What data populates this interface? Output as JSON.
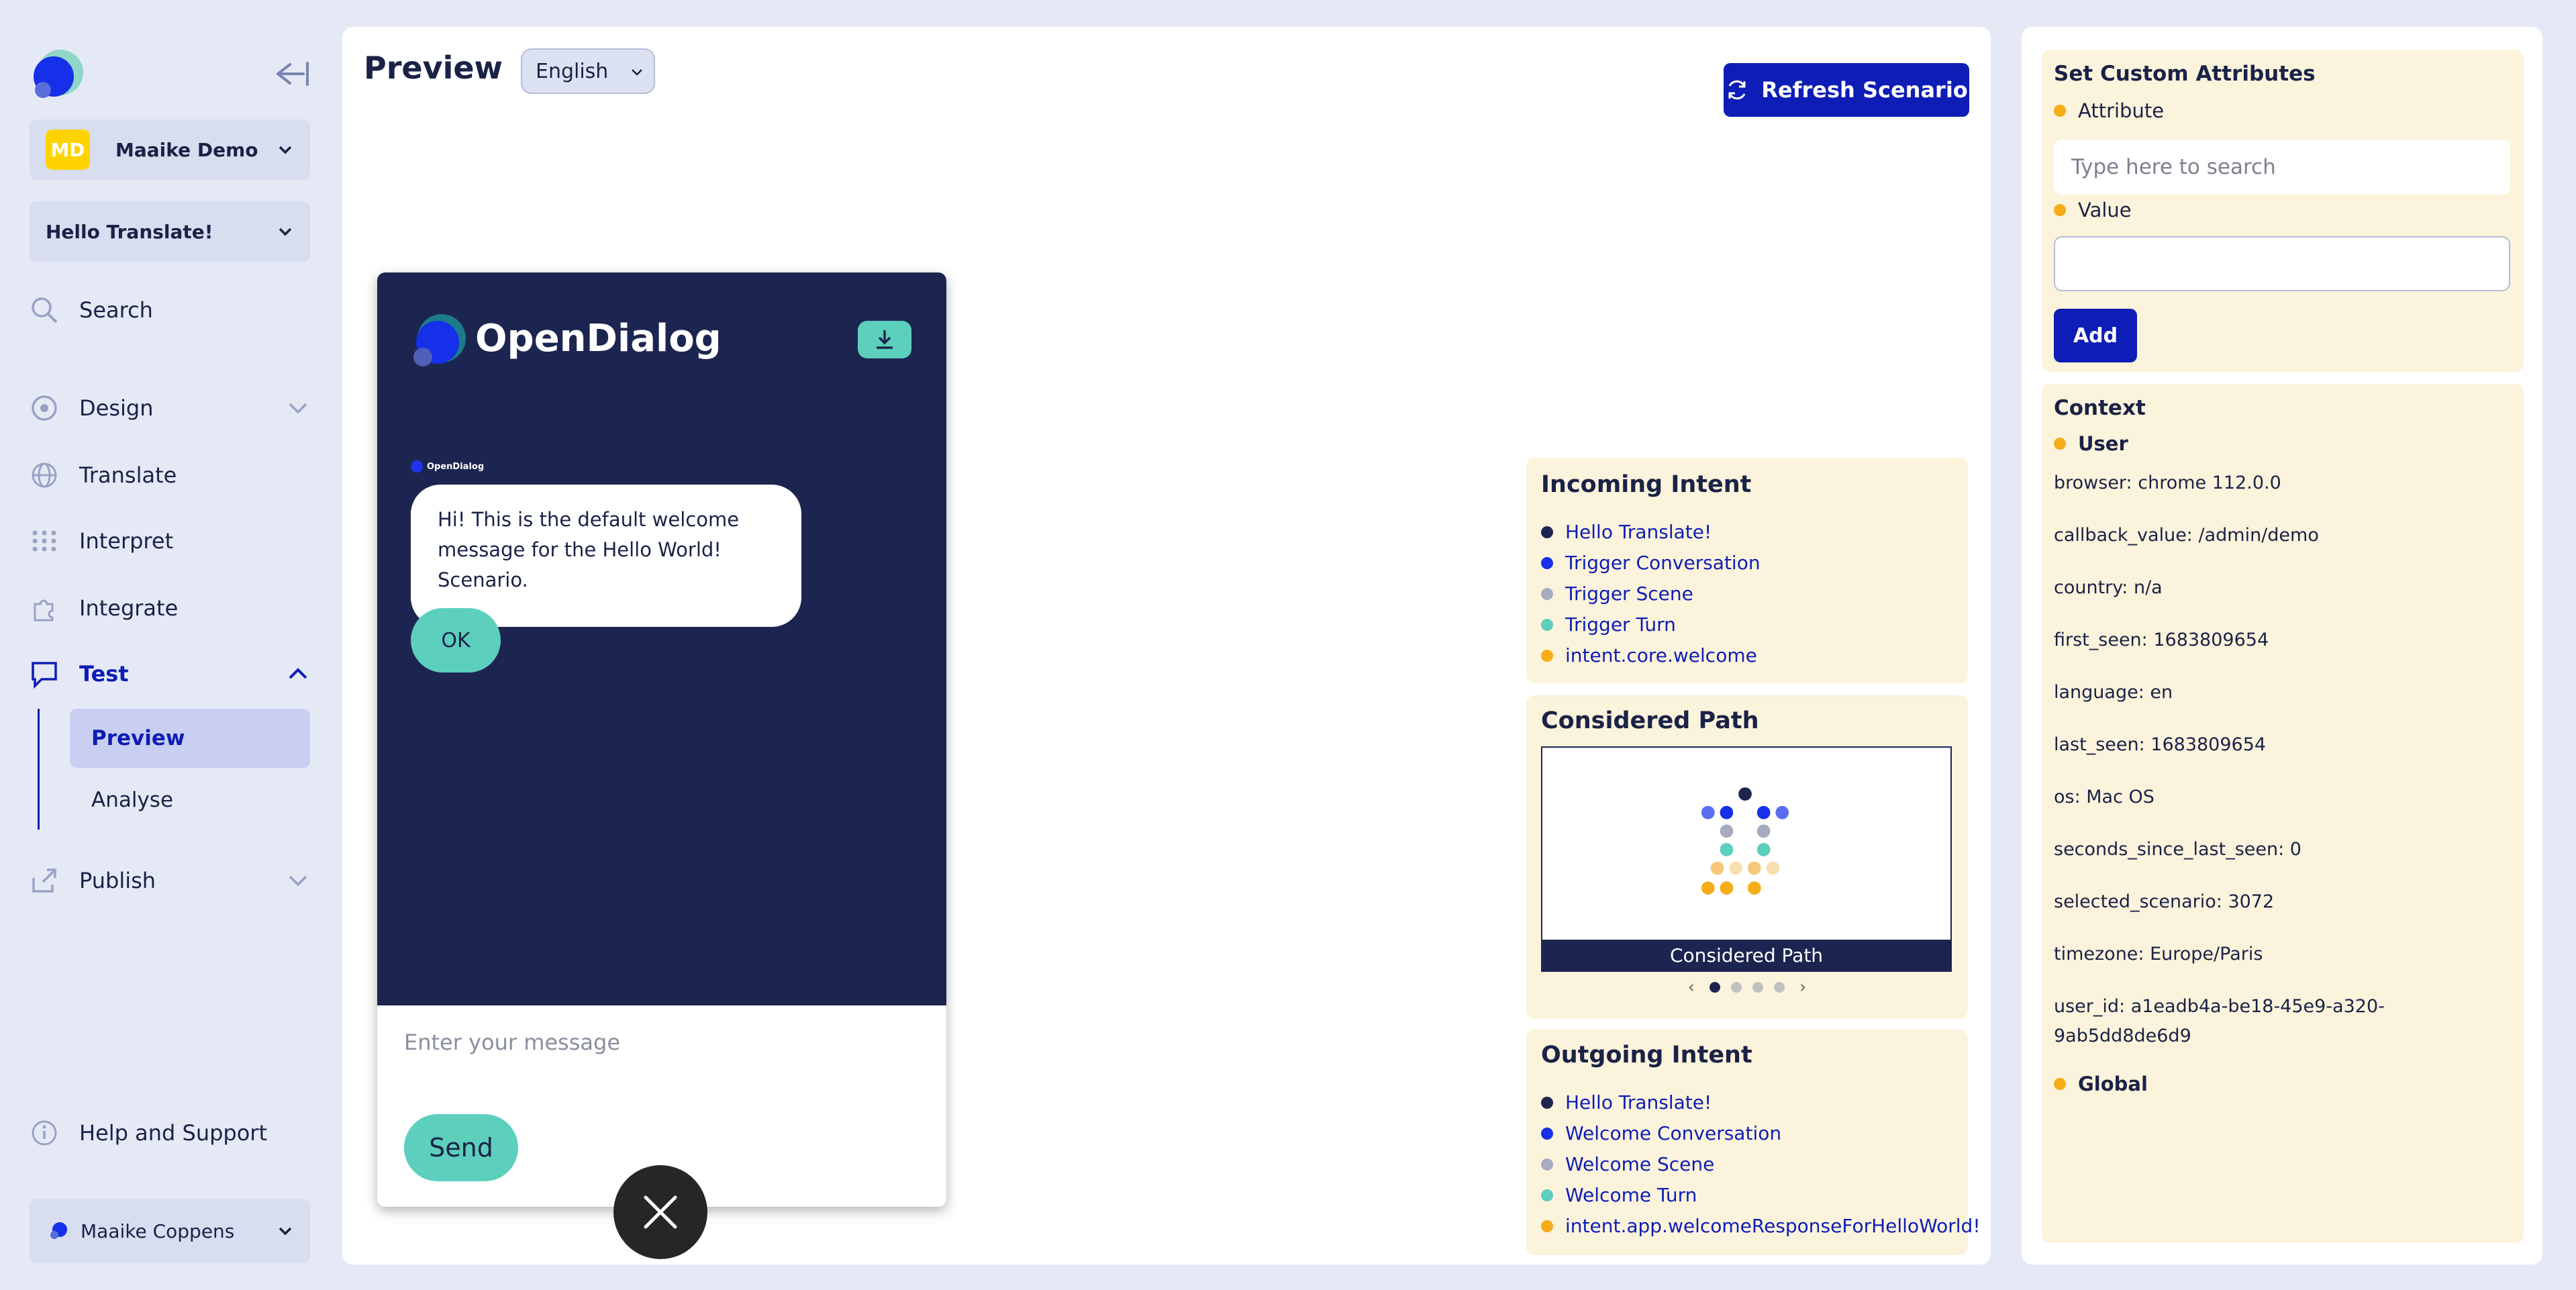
{
  "sidebar": {
    "workspace": {
      "initials": "MD",
      "name": "Maaike Demo"
    },
    "scenario": "Hello Translate!",
    "nav": {
      "search": "Search",
      "design": "Design",
      "translate": "Translate",
      "interpret": "Interpret",
      "integrate": "Integrate",
      "test": "Test",
      "preview": "Preview",
      "analyse": "Analyse",
      "publish": "Publish",
      "help": "Help and Support"
    },
    "user": "Maaike Coppens"
  },
  "main": {
    "title": "Preview",
    "language": "English",
    "refresh_label": "Refresh Scenario"
  },
  "widget": {
    "brand": "OpenDialog",
    "small_brand": "OpenDialog",
    "message": "Hi! This is the default welcome message for the Hello World! Scenario.",
    "ok_label": "OK",
    "input_placeholder": "Enter your message",
    "send_label": "Send"
  },
  "incoming": {
    "title": "Incoming Intent",
    "items": [
      {
        "label": "Hello Translate!",
        "color": "#1c2550"
      },
      {
        "label": "Trigger Conversation",
        "color": "#1530e8"
      },
      {
        "label": "Trigger Scene",
        "color": "#a7abc0"
      },
      {
        "label": "Trigger Turn",
        "color": "#5ccfbd"
      },
      {
        "label": "intent.core.welcome",
        "color": "#f5ad18"
      }
    ]
  },
  "considered": {
    "title": "Considered Path",
    "caption": "Considered Path",
    "prev": "‹",
    "next": "›",
    "pages": 5,
    "active_page": 1
  },
  "outgoing": {
    "title": "Outgoing Intent",
    "items": [
      {
        "label": "Hello Translate!",
        "color": "#1c2550"
      },
      {
        "label": "Welcome Conversation",
        "color": "#1530e8"
      },
      {
        "label": "Welcome Scene",
        "color": "#a7abc0"
      },
      {
        "label": "Welcome Turn",
        "color": "#5ccfbd"
      },
      {
        "label": "intent.app.welcomeResponseForHelloWorld!",
        "color": "#f5ad18"
      }
    ]
  },
  "attributes": {
    "title": "Set Custom Attributes",
    "attribute_label": "Attribute",
    "attribute_placeholder": "Type here to search",
    "value_label": "Value",
    "value": "",
    "add_label": "Add"
  },
  "context": {
    "title": "Context",
    "user_label": "User",
    "lines": [
      "browser: chrome 112.0.0",
      "callback_value: /admin/demo",
      "country: n/a",
      "first_seen: 1683809654",
      "language: en",
      "last_seen: 1683809654",
      "os: Mac OS",
      "seconds_since_last_seen: 0",
      "selected_scenario: 3072",
      "timezone: Europe/Paris",
      "user_id: a1eadb4a-be18-45e9-a320-9ab5dd8de6d9"
    ],
    "global_label": "Global"
  },
  "colors": {
    "accent": "#0d1db5",
    "navy": "#1c2550",
    "teal": "#5ccfbd",
    "amber": "#f5ad18",
    "card": "#fcf3dc"
  }
}
